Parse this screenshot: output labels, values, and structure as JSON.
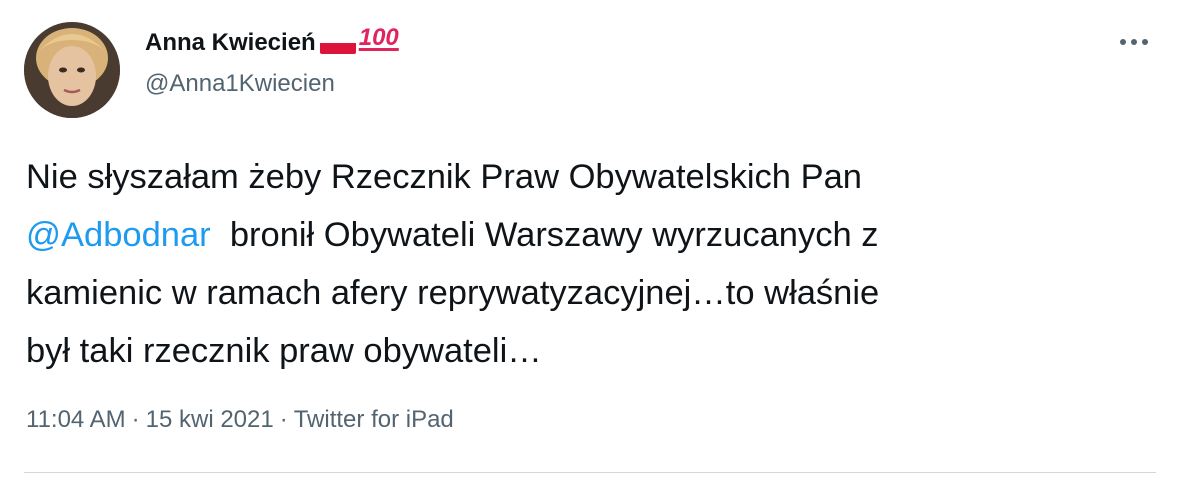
{
  "author": {
    "display_name": "Anna Kwiecień",
    "badge_emoji": "💯",
    "flag_icon": "poland-flag-icon",
    "handle": "@Anna1Kwiecien"
  },
  "tweet": {
    "text_before": "Nie słyszałam żeby Rzecznik Praw Obywatelskich Pan\n",
    "mention": "@Adbodnar",
    "text_after": "  bronił Obywateli Warszawy wyrzucanych z\nkamienic w ramach afery reprywatyzacyjnej…to właśnie\nbył taki rzecznik praw obywateli…",
    "time": "11:04 AM",
    "date": "15 kwi 2021",
    "separator": "·",
    "source": "Twitter for iPad"
  },
  "menu_icon": "more-icon",
  "colors": {
    "text": "#0f1419",
    "secondary": "#536471",
    "link": "#1d9bf0",
    "divider": "#cfd9de"
  }
}
